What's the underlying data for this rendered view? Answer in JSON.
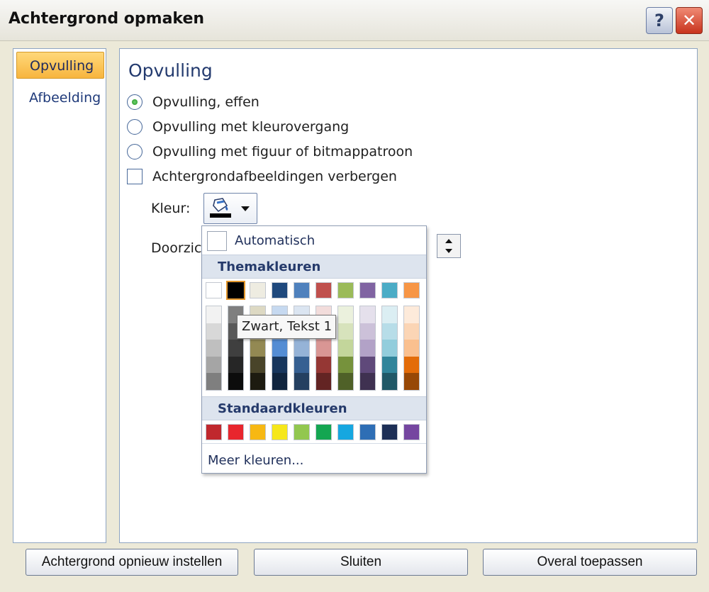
{
  "window": {
    "title": "Achtergrond opmaken",
    "help_glyph": "?",
    "close_glyph": "✕"
  },
  "nav": {
    "items": [
      {
        "label": "Opvulling",
        "active": true
      },
      {
        "label": "Afbeelding",
        "active": false
      }
    ]
  },
  "fill": {
    "section_title": "Opvulling",
    "options": [
      {
        "label": "Opvulling, effen",
        "checked": true
      },
      {
        "label": "Opvulling met kleurovergang",
        "checked": false
      },
      {
        "label": "Opvulling met figuur of bitmappatroon",
        "checked": false
      }
    ],
    "hide_bg_label": "Achtergrondafbeeldingen verbergen",
    "hide_bg_checked": false,
    "color_label": "Kleur:",
    "transparency_label": "Doorzich",
    "color_button_icon": "paint-bucket-icon"
  },
  "color_popup": {
    "automatic_label": "Automatisch",
    "theme_header": "Themakleuren",
    "standard_header": "Standaardkleuren",
    "more_colors_label": "Meer kleuren...",
    "theme_colors": [
      "#ffffff",
      "#000000",
      "#eeece1",
      "#1f497d",
      "#4f81bd",
      "#c0504d",
      "#9bbb59",
      "#8064a2",
      "#4bacc6",
      "#f79646"
    ],
    "selected_theme_index": 1,
    "theme_shades": [
      [
        "#f2f2f2",
        "#d8d8d8",
        "#bfbfbf",
        "#a5a5a5",
        "#7f7f7f"
      ],
      [
        "#7f7f7f",
        "#595959",
        "#3f3f3f",
        "#262626",
        "#0c0c0c"
      ],
      [
        "#ddd9c3",
        "#c4bd97",
        "#938953",
        "#494429",
        "#1d1b10"
      ],
      [
        "#c6d9f0",
        "#8db3e2",
        "#548dd4",
        "#17365d",
        "#0f243e"
      ],
      [
        "#dbe5f1",
        "#b8cce4",
        "#95b3d7",
        "#366092",
        "#244061"
      ],
      [
        "#f2dcdb",
        "#e5b9b7",
        "#d99694",
        "#953734",
        "#632423"
      ],
      [
        "#ebf1dd",
        "#d7e3bc",
        "#c3d69b",
        "#76923c",
        "#4f6128"
      ],
      [
        "#e5e0ec",
        "#ccc1d9",
        "#b2a2c7",
        "#5f497a",
        "#3f3151"
      ],
      [
        "#dbeef3",
        "#b7dde8",
        "#92cddc",
        "#31859b",
        "#205867"
      ],
      [
        "#fdeada",
        "#fbd5b5",
        "#fac08f",
        "#e36c09",
        "#974806"
      ]
    ],
    "standard_colors": [
      "#c0282d",
      "#e8262d",
      "#f7b813",
      "#f6e71a",
      "#92c74f",
      "#14a651",
      "#16a7e0",
      "#2e6eb5",
      "#1d2f56",
      "#7546a0"
    ]
  },
  "tooltip": {
    "text": "Zwart, Tekst 1"
  },
  "buttons": {
    "reset": "Achtergrond opnieuw instellen",
    "close": "Sluiten",
    "apply_all": "Overal toepassen"
  }
}
